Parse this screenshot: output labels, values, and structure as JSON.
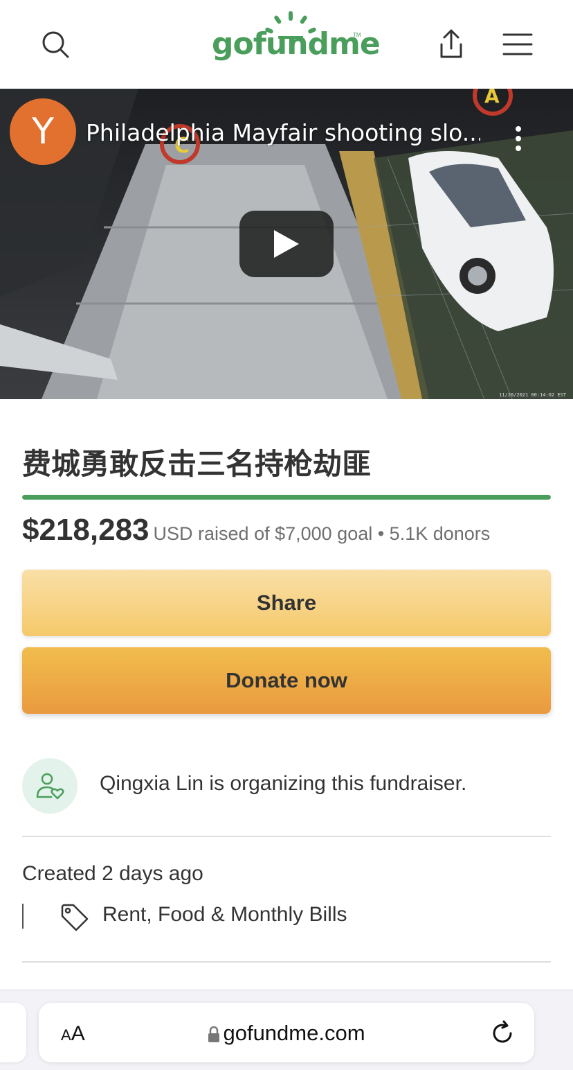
{
  "header": {
    "logo_text": "gofundme",
    "logo_tm": "TM",
    "icons": [
      "search-icon",
      "share-upload-icon",
      "menu-icon"
    ]
  },
  "video": {
    "channel_initial": "Y",
    "title": "Philadelphia Mayfair shooting slo...",
    "timestamp": "11/20/2021 00:14:02 EST"
  },
  "campaign": {
    "title": "费城勇敢反击三名持枪劫匪",
    "progress_fraction": 1.0,
    "amount": "$218,283",
    "amount_detail": "USD raised of $7,000 goal • 5.1K donors"
  },
  "actions": {
    "share_label": "Share",
    "donate_label": "Donate now"
  },
  "organizer": {
    "text": "Qingxia Lin is organizing this fundraiser."
  },
  "meta": {
    "created": "Created 2 days ago",
    "category": "Rent, Food & Monthly Bills"
  },
  "browser": {
    "aa_small": "A",
    "aa_large": "A",
    "url": "gofundme.com"
  },
  "colors": {
    "brand_green": "#4a9e5c",
    "share_button": "#f7d48c",
    "donate_button": "#eeac45",
    "avatar_orange": "#e2712f"
  }
}
